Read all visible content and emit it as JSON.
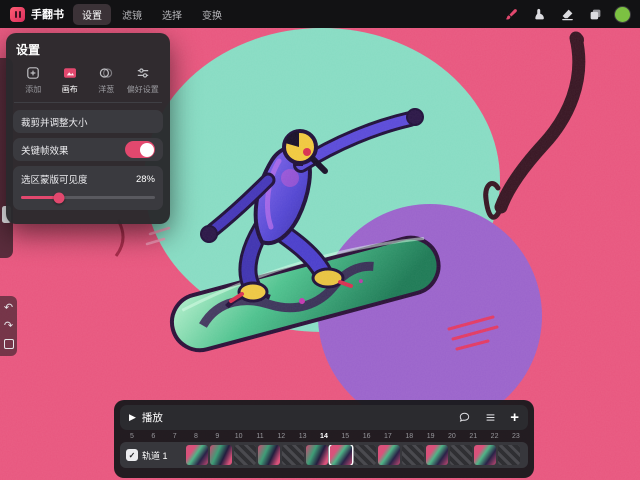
{
  "colors": {
    "accent": "#e2486e",
    "color_swatch": "#7cc142",
    "canvas_pink": "#e8567e",
    "canvas_teal": "#87dcc3",
    "canvas_purple": "#9a63cb"
  },
  "topbar": {
    "app_title": "手翻书",
    "menu": [
      {
        "label": "设置",
        "active": true
      },
      {
        "label": "滤镜",
        "active": false
      },
      {
        "label": "选择",
        "active": false
      },
      {
        "label": "变换",
        "active": false
      }
    ]
  },
  "settings_panel": {
    "title": "设置",
    "tabs": [
      {
        "label": "添加",
        "active": false
      },
      {
        "label": "画布",
        "active": true
      },
      {
        "label": "洋葱",
        "active": false
      },
      {
        "label": "偏好设置",
        "active": false
      }
    ],
    "rows": {
      "crop": {
        "label": "裁剪并调整大小"
      },
      "keyframe": {
        "label": "关键帧效果",
        "toggle_on": true
      },
      "mask": {
        "label": "选区蒙版可见度",
        "value": "28%",
        "percent": 28
      }
    }
  },
  "timeline": {
    "play_label": "播放",
    "ruler": [
      "5",
      "6",
      "7",
      "8",
      "9",
      "10",
      "11",
      "12",
      "13",
      "14",
      "15",
      "16",
      "17",
      "18",
      "19",
      "20",
      "21",
      "22",
      "23"
    ],
    "current_frame": "14",
    "current_index": 6,
    "track": {
      "name": "轨道 1",
      "checked": true
    },
    "frames": [
      "art",
      "art",
      "empty",
      "art",
      "empty",
      "art",
      "art",
      "empty",
      "art",
      "empty",
      "art",
      "empty",
      "art",
      "empty"
    ]
  },
  "icons": {
    "undo": "↶",
    "redo": "↷",
    "play": "▶",
    "plus": "+",
    "check": "✓"
  }
}
